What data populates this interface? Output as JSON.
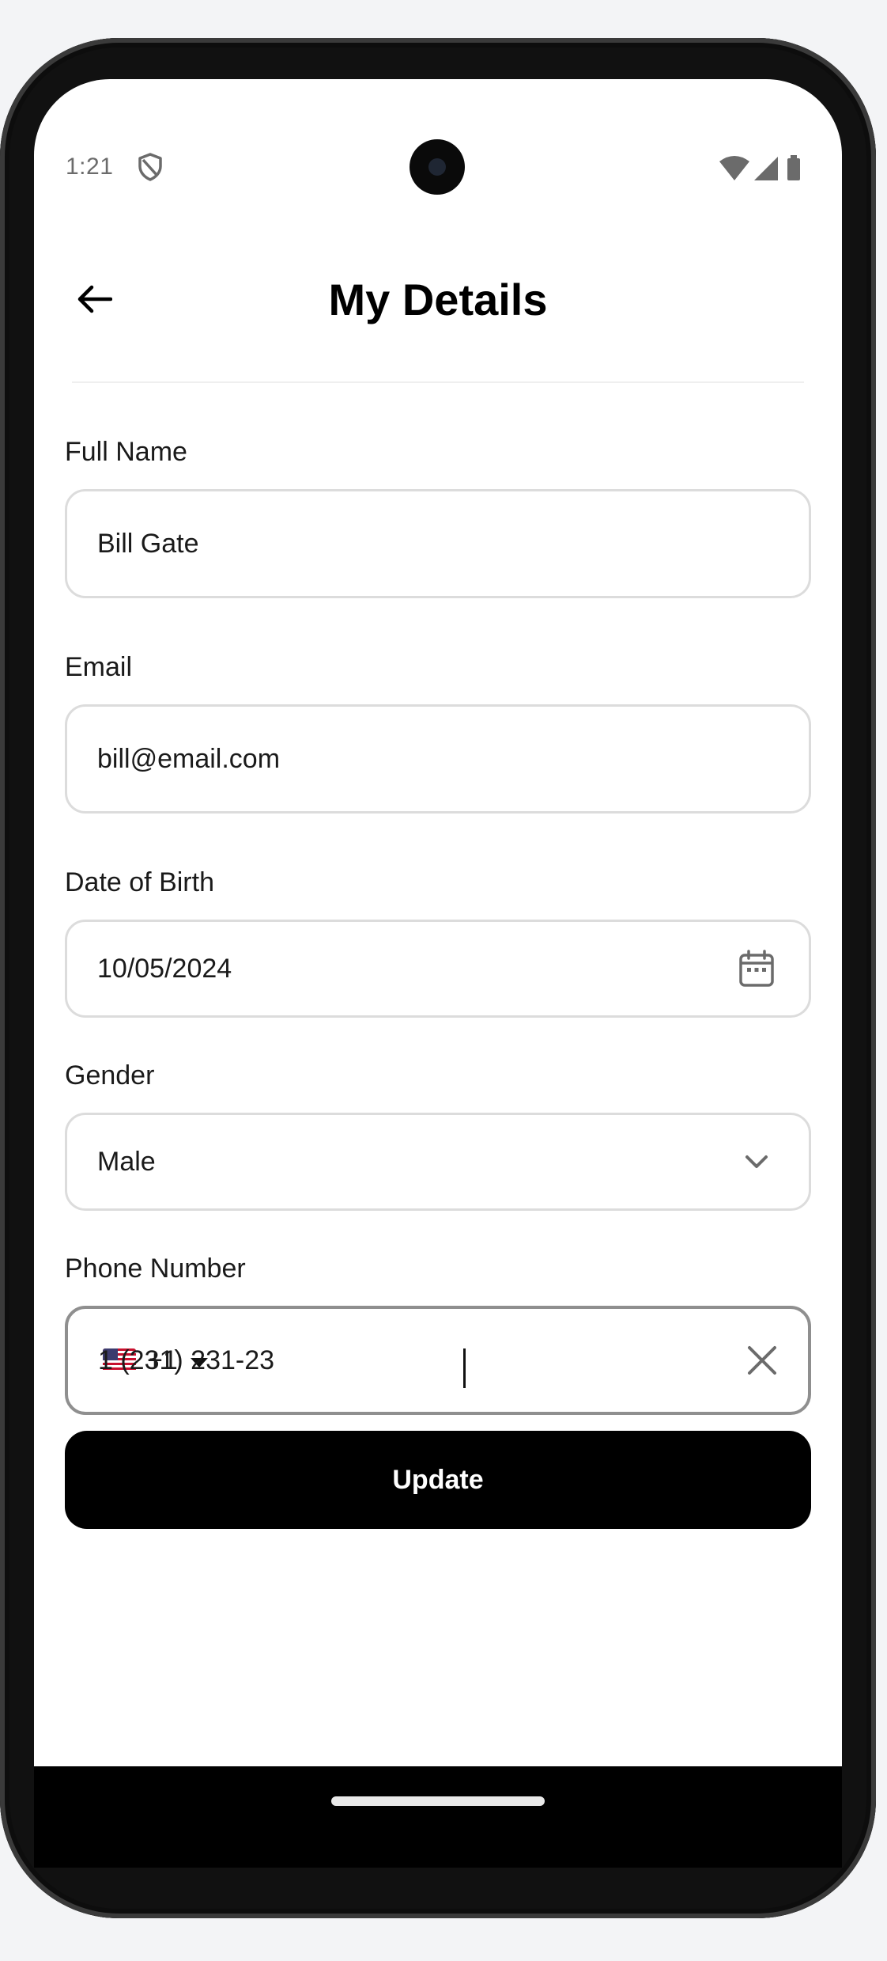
{
  "status_bar": {
    "time": "1:21",
    "icons": [
      "shield-icon",
      "wifi-icon",
      "signal-icon",
      "battery-icon"
    ]
  },
  "header": {
    "title": "My Details",
    "back_icon": "arrow-left-icon"
  },
  "form": {
    "full_name": {
      "label": "Full Name",
      "value": "Bill Gate"
    },
    "email": {
      "label": "Email",
      "value": "bill@email.com"
    },
    "date_of_birth": {
      "label": "Date of Birth",
      "value": "10/05/2024",
      "icon": "calendar-icon"
    },
    "gender": {
      "label": "Gender",
      "value": "Male",
      "icon": "chevron-down-icon"
    },
    "phone": {
      "label": "Phone Number",
      "country_flag": "us-flag-icon",
      "country_code": "+1",
      "value": "1 (231) 231-23",
      "clear_icon": "close-icon"
    }
  },
  "actions": {
    "update_label": "Update"
  },
  "colors": {
    "primary": "#000000",
    "field_border": "#dcdcdc",
    "focused_border": "#8f8f8f",
    "background": "#ffffff"
  }
}
